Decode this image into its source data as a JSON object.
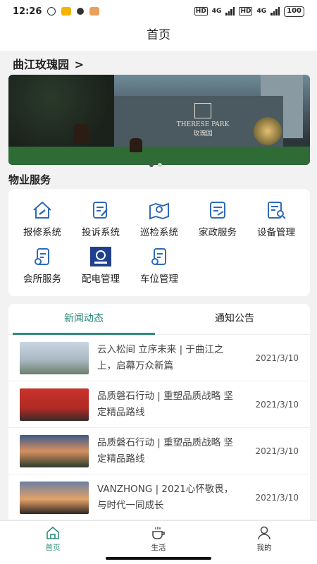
{
  "status_bar": {
    "time": "12:26",
    "battery": "100",
    "net1": "4G",
    "net2": "4G"
  },
  "title": "首页",
  "community": {
    "name": "曲江玫瑰园",
    "chevron": ">"
  },
  "banner": {
    "brand_en": "THERESE PARK",
    "brand_cn": "玫瑰园",
    "active_slide": 1,
    "slide_count": 2
  },
  "services": {
    "title": "物业服务",
    "items": [
      {
        "label": "报修系统",
        "icon": "repair-house-icon"
      },
      {
        "label": "投诉系统",
        "icon": "complaint-edit-icon"
      },
      {
        "label": "巡检系统",
        "icon": "map-location-icon"
      },
      {
        "label": "家政服务",
        "icon": "housekeeping-icon"
      },
      {
        "label": "设备管理",
        "icon": "device-search-icon"
      },
      {
        "label": "会所服务",
        "icon": "clubhouse-icon"
      },
      {
        "label": "配电管理",
        "icon": "power-logo-icon"
      },
      {
        "label": "车位管理",
        "icon": "parking-icon"
      }
    ]
  },
  "news": {
    "tabs": [
      {
        "label": "新闻动态"
      },
      {
        "label": "通知公告"
      }
    ],
    "items": [
      {
        "title": "云入松间 立序未来 | 于曲江之上，启幕万众新篇",
        "date": "2021/3/10"
      },
      {
        "title": "品质磐石行动 | 重塑品质战略 坚定精品路线",
        "date": "2021/3/10"
      },
      {
        "title": "品质磐石行动 | 重塑品质战略 坚定精品路线",
        "date": "2021/3/10"
      },
      {
        "title": "VANZHONG | 2021心怀敬畏，与时代一同成长",
        "date": "2021/3/10"
      }
    ]
  },
  "bottom_nav": [
    {
      "label": "首页",
      "icon": "home-icon"
    },
    {
      "label": "生活",
      "icon": "coffee-cup-icon"
    },
    {
      "label": "我的",
      "icon": "user-icon"
    }
  ],
  "colors": {
    "accent": "#2e8b7b",
    "icon_blue": "#2f6bb5",
    "background": "#f2f2f2"
  }
}
